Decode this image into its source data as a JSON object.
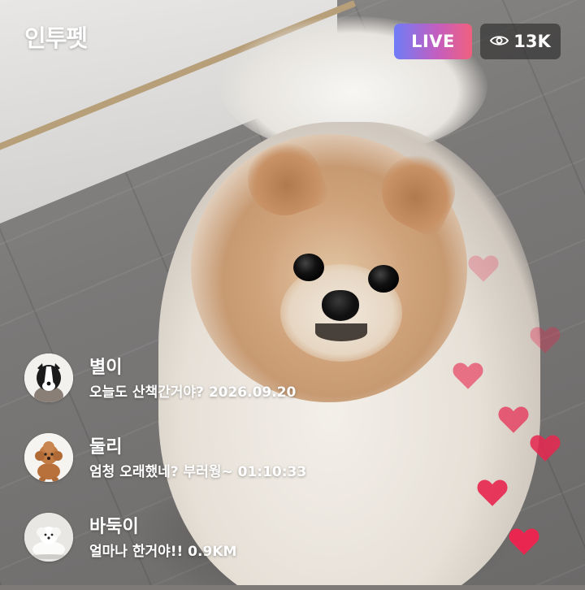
{
  "header": {
    "app_title": "인투펫",
    "live_label": "LIVE",
    "viewer_count": "13K",
    "viewer_icon": "eye-icon"
  },
  "comments": [
    {
      "name": "별이",
      "text": "오늘도 산책간거야? 2026.09.20",
      "avatar": "border-collie-avatar"
    },
    {
      "name": "둘리",
      "text": "엄청 오래했네? 부러웡~ 01:10:33",
      "avatar": "poodle-avatar"
    },
    {
      "name": "바둑이",
      "text": "얼마나 한거야!! 0.9KM",
      "avatar": "white-dog-avatar"
    }
  ],
  "reactions": {
    "icon": "heart-icon",
    "color": "#e8264f"
  },
  "colors": {
    "live_gradient": [
      "#6f7cf7",
      "#c35ec0",
      "#f0607e"
    ],
    "overlay_text": "#ffffff",
    "viewer_badge_bg": "#282828"
  }
}
